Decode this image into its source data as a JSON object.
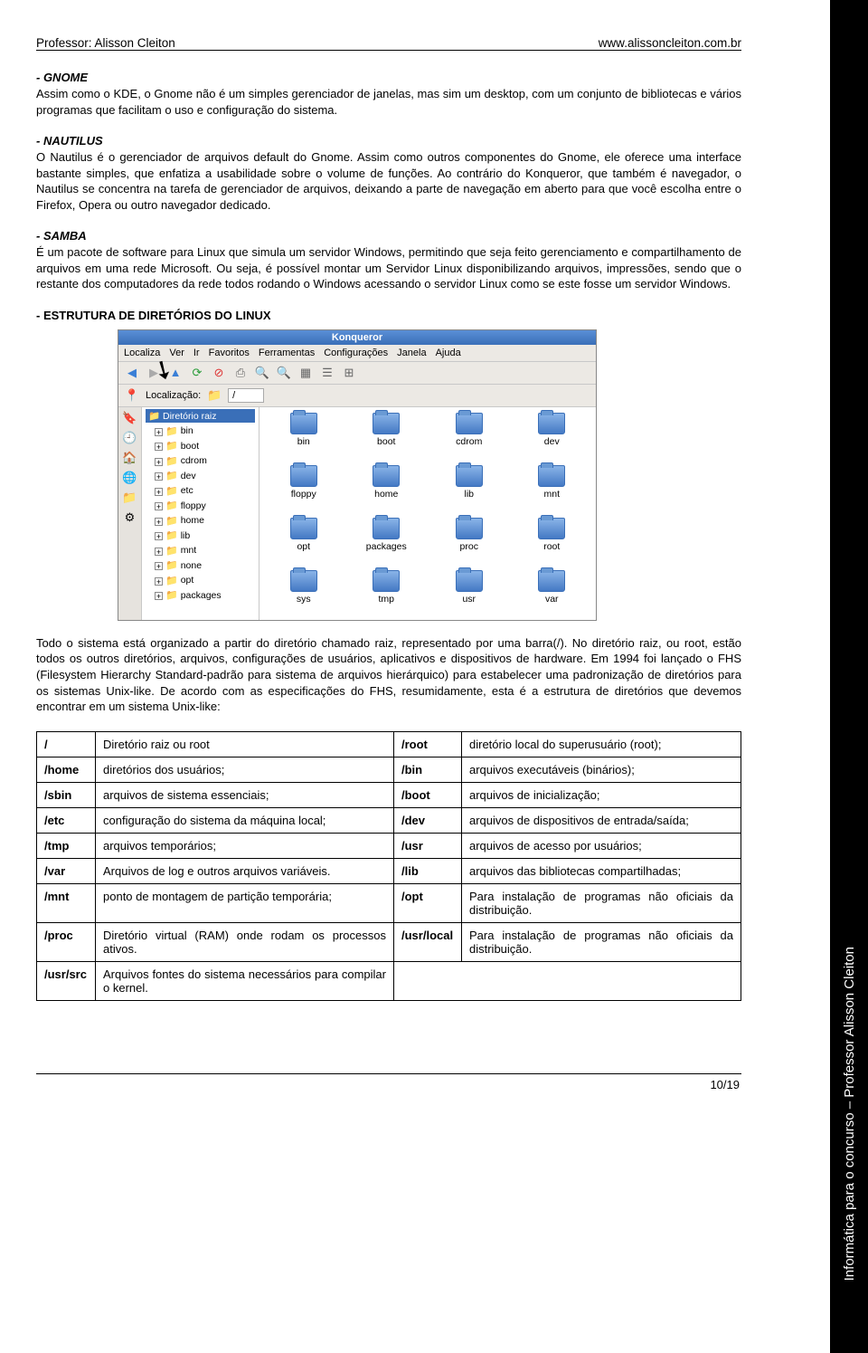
{
  "header": {
    "left": "Professor: Alisson Cleiton",
    "right": "www.alissoncleiton.com.br"
  },
  "sidebar_text": "Informática para o concurso – Professor Alisson Cleiton",
  "gnome": {
    "title": "- GNOME",
    "text": "Assim como o KDE, o Gnome não é um simples gerenciador de janelas, mas sim um desktop, com um conjunto de bibliotecas e vários programas que facilitam o uso e configuração do sistema."
  },
  "nautilus": {
    "title": "- NAUTILUS",
    "text": "O Nautilus é o gerenciador de arquivos default do Gnome. Assim como outros componentes do Gnome, ele oferece uma interface bastante simples, que enfatiza a usabilidade sobre o volume de funções. Ao contrário do Konqueror, que também é navegador, o Nautilus se concentra na tarefa de gerenciador de arquivos, deixando a parte de navegação em aberto para que você escolha entre o Firefox, Opera ou outro navegador dedicado."
  },
  "samba": {
    "title": "- SAMBA",
    "text": "É um pacote de software para Linux que simula um servidor Windows, permitindo que seja feito gerenciamento e compartilhamento de arquivos em uma rede Microsoft. Ou seja, é possível montar um Servidor Linux disponibilizando arquivos, impressões, sendo que o restante dos computadores da rede todos rodando o Windows acessando o servidor Linux como se este fosse um servidor Windows."
  },
  "estrutura_title": "- ESTRUTURA DE DIRETÓRIOS DO LINUX",
  "kq": {
    "title": "Konqueror",
    "menu": [
      "Localiza",
      "Ver",
      "Ir",
      "Favoritos",
      "Ferramentas",
      "Configurações",
      "Janela",
      "Ajuda"
    ],
    "loc_label": "Localização:",
    "loc_value": "/",
    "tree_root": "Diretório raiz",
    "tree": [
      "bin",
      "boot",
      "cdrom",
      "dev",
      "etc",
      "floppy",
      "home",
      "lib",
      "mnt",
      "none",
      "opt",
      "packages"
    ],
    "folders": [
      "bin",
      "boot",
      "cdrom",
      "dev",
      "floppy",
      "home",
      "lib",
      "mnt",
      "opt",
      "packages",
      "proc",
      "root",
      "sys",
      "tmp",
      "usr",
      "var"
    ]
  },
  "after_kq": "Todo o sistema está organizado a partir do diretório chamado raiz, representado por uma barra(/). No diretório raiz, ou root, estão todos os outros diretórios, arquivos, configurações de usuários, aplicativos e dispositivos de hardware. Em 1994 foi lançado o FHS (Filesystem Hierarchy Standard-padrão para sistema de arquivos hierárquico) para estabelecer uma padronização de diretórios para os sistemas Unix-like. De acordo com as especificações do FHS, resumidamente, esta é a estrutura de diretórios que devemos encontrar em um sistema Unix-like:",
  "dirs": [
    {
      "a": "/",
      "b": "Diretório raiz ou root",
      "c": "/root",
      "d": "diretório local do superusuário (root);"
    },
    {
      "a": "/home",
      "b": "diretórios dos usuários;",
      "c": "/bin",
      "d": "arquivos executáveis (binários);"
    },
    {
      "a": "/sbin",
      "b": "arquivos de sistema essenciais;",
      "c": "/boot",
      "d": "arquivos de inicialização;"
    },
    {
      "a": "/etc",
      "b": "configuração do sistema da máquina local;",
      "c": "/dev",
      "d": "arquivos de dispositivos de entrada/saída;"
    },
    {
      "a": "/tmp",
      "b": "arquivos temporários;",
      "c": "/usr",
      "d": "arquivos de acesso por usuários;"
    },
    {
      "a": "/var",
      "b": "Arquivos de log e outros arquivos variáveis.",
      "c": "/lib",
      "d": "arquivos das bibliotecas compartilhadas;"
    },
    {
      "a": "/mnt",
      "b": "ponto de montagem de partição temporária;",
      "c": "/opt",
      "d": "Para instalação de programas não oficiais da distribuição."
    },
    {
      "a": "/proc",
      "b": "Diretório virtual (RAM) onde rodam os processos ativos.",
      "c": "/usr/local",
      "d": "Para instalação de programas não oficiais da distribuição."
    },
    {
      "a": "/usr/src",
      "b": "Arquivos fontes do sistema necessários para compilar o kernel.",
      "c": "",
      "d": ""
    }
  ],
  "footer": "10/19"
}
